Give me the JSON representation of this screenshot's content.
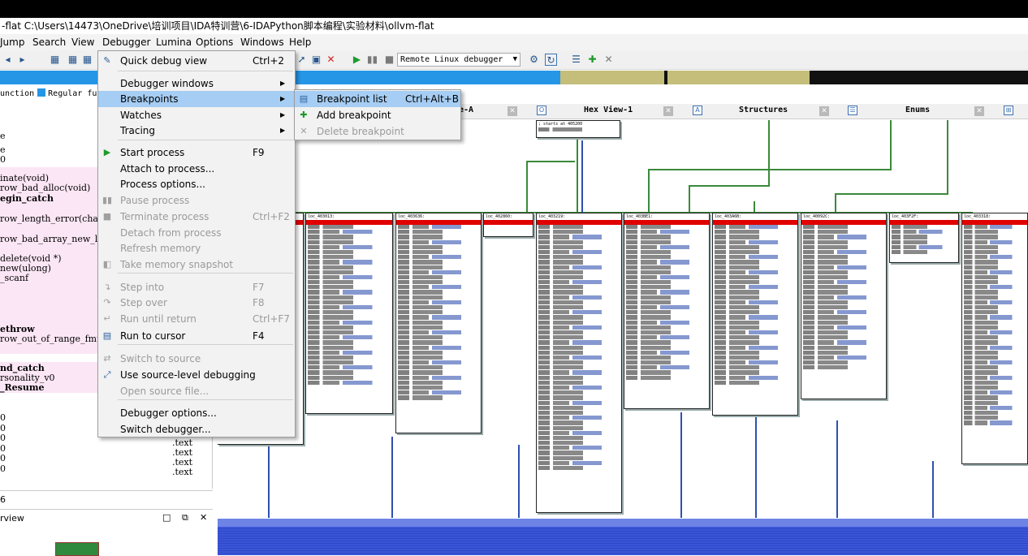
{
  "window": {
    "title": "-flat C:\\Users\\14473\\OneDrive\\培训项目\\IDA特训营\\6-IDAPython脚本编程\\实验材料\\ollvm-flat"
  },
  "menubar": [
    "Jump",
    "Search",
    "View",
    "Debugger",
    "Lumina",
    "Options",
    "Windows",
    "Help"
  ],
  "toolbar": {
    "debugger_select": "Remote Linux debugger"
  },
  "legend": {
    "function_text": "unction",
    "regular_text": "Regular func"
  },
  "functions": [
    {
      "text": "e",
      "bold": false
    },
    {
      "text": "e",
      "bold": false
    },
    {
      "text": "0",
      "bold": false
    },
    {
      "text": "inate(void)",
      "bold": false
    },
    {
      "text": "row_bad_alloc(void)",
      "bold": false
    },
    {
      "text": "egin_catch",
      "bold": true
    },
    {
      "text": "row_length_error(char c",
      "bold": false
    },
    {
      "text": "row_bad_array_new_lengt",
      "bold": false
    },
    {
      "text": "delete(void *)",
      "bold": false
    },
    {
      "text": "new(ulong)",
      "bold": false
    },
    {
      "text": "_scanf",
      "bold": false
    },
    {
      "text": "ethrow",
      "bold": true
    },
    {
      "text": "row_out_of_range_fmt(ch",
      "bold": false
    },
    {
      "text": "nd_catch",
      "bold": true
    },
    {
      "text": "rsonality_v0",
      "bold": false
    },
    {
      "text": "_Resume",
      "bold": true
    }
  ],
  "function_tail": {
    "rows": [
      "0",
      "0",
      "0",
      "0",
      "0",
      "0"
    ],
    "segments": [
      ".text",
      ".text",
      ".text",
      ".text"
    ]
  },
  "status_text": "6",
  "overview": {
    "title": "rview"
  },
  "tabs": [
    {
      "label": "e-A"
    },
    {
      "label": "Hex View-1"
    },
    {
      "label": "Structures"
    },
    {
      "label": "Enums"
    }
  ],
  "top_block": {
    "lines": [
      "; starts at 405200"
    ]
  },
  "blocks": [
    {
      "name": "loc_403013:"
    },
    {
      "name": "loc_403636:"
    },
    {
      "name": "loc_402860:"
    },
    {
      "name": "loc_403219:"
    },
    {
      "name": "loc_403BE1:"
    },
    {
      "name": "loc_403A6B:"
    },
    {
      "name": "loc_40092C:"
    },
    {
      "name": "loc_403F2F:"
    },
    {
      "name": "loc_403318:"
    }
  ],
  "debugger_menu": {
    "items": [
      {
        "label": "Quick debug view",
        "shortcut": "Ctrl+2",
        "icon": "quick-debug-icon",
        "enabled": true
      },
      {
        "label": "Debugger windows",
        "submenu": true,
        "enabled": true
      },
      {
        "label": "Breakpoints",
        "submenu": true,
        "enabled": true,
        "highlighted": true
      },
      {
        "label": "Watches",
        "submenu": true,
        "enabled": true
      },
      {
        "label": "Tracing",
        "submenu": true,
        "enabled": true
      },
      {
        "label": "Start process",
        "shortcut": "F9",
        "icon": "play-icon",
        "enabled": true
      },
      {
        "label": "Attach to process...",
        "enabled": true
      },
      {
        "label": "Process options...",
        "enabled": true
      },
      {
        "label": "Pause process",
        "icon": "pause-icon",
        "enabled": false
      },
      {
        "label": "Terminate process",
        "shortcut": "Ctrl+F2",
        "icon": "stop-icon",
        "enabled": false
      },
      {
        "label": "Detach from process",
        "enabled": false
      },
      {
        "label": "Refresh memory",
        "enabled": false
      },
      {
        "label": "Take memory snapshot",
        "icon": "snapshot-icon",
        "enabled": false
      },
      {
        "label": "Step into",
        "shortcut": "F7",
        "icon": "step-into-icon",
        "enabled": false
      },
      {
        "label": "Step over",
        "shortcut": "F8",
        "icon": "step-over-icon",
        "enabled": false
      },
      {
        "label": "Run until return",
        "shortcut": "Ctrl+F7",
        "icon": "run-until-return-icon",
        "enabled": false
      },
      {
        "label": "Run to cursor",
        "shortcut": "F4",
        "icon": "run-to-cursor-icon",
        "enabled": true
      },
      {
        "label": "Switch to source",
        "icon": "switch-source-icon",
        "enabled": false
      },
      {
        "label": "Use source-level debugging",
        "icon": "source-debug-icon",
        "enabled": true
      },
      {
        "label": "Open source file...",
        "enabled": false
      },
      {
        "label": "Debugger options...",
        "enabled": true
      },
      {
        "label": "Switch debugger...",
        "enabled": true
      }
    ]
  },
  "breakpoints_submenu": {
    "items": [
      {
        "label": "Breakpoint list",
        "shortcut": "Ctrl+Alt+B",
        "icon": "breakpoint-list-icon",
        "enabled": true,
        "highlighted": true
      },
      {
        "label": "Add breakpoint",
        "icon": "add-breakpoint-icon",
        "enabled": true
      },
      {
        "label": "Delete breakpoint",
        "icon": "delete-breakpoint-icon",
        "enabled": false
      }
    ]
  },
  "colors": {
    "accent": "#2596e6",
    "menu_highlight": "#a6cdf3",
    "breakpoint_red": "#e00000",
    "pink_row": "#fbe6f5",
    "graph_edge_green": "#3a8a3a",
    "graph_edge_blue": "#3050b0"
  }
}
